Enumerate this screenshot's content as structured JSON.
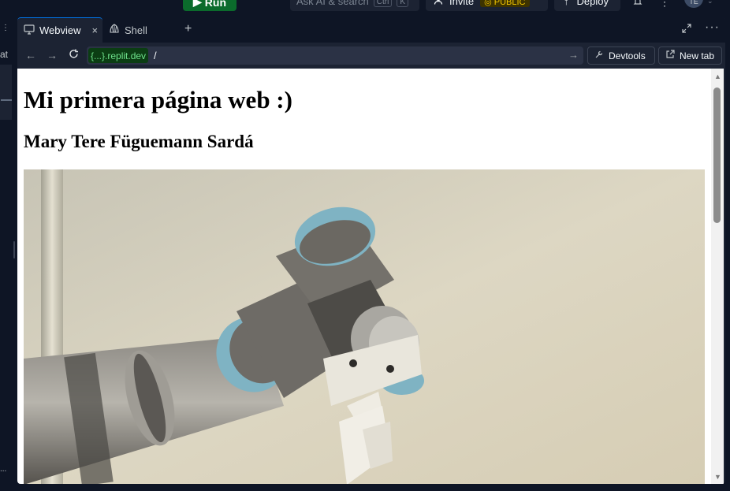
{
  "topbar": {
    "run_label": "Run",
    "search_placeholder": "Ask AI & search",
    "search_shortcut_mod": "Ctrl",
    "search_shortcut_key": "K",
    "invite_label": "Invite",
    "public_badge": "PUBLIC",
    "deploy_label": "Deploy",
    "avatar_initials": "TE"
  },
  "left_strip": {
    "dots_top": "⋮",
    "partial_label": "at",
    "dots_bottom": "..."
  },
  "tabs": [
    {
      "label": "Webview",
      "icon": "monitor-icon",
      "active": true
    },
    {
      "label": "Shell",
      "icon": "shell-icon",
      "active": false
    }
  ],
  "urlbar": {
    "domain": "{...}.replit.dev",
    "path": "/",
    "devtools_label": "Devtools",
    "newtab_label": "New tab"
  },
  "webpage": {
    "heading": "Mi primera página web :)",
    "subheading": "Mary Tere Füguemann Sardá",
    "image": "robot-arm-photo"
  },
  "colors": {
    "run_green": "#0b6b2c",
    "accent_blue": "#0079f2",
    "public_yellow": "#f0c400",
    "url_domain_green": "#6fe28c",
    "robot_teal": "#7fb3c3",
    "robot_gray": "#6e6b66"
  }
}
